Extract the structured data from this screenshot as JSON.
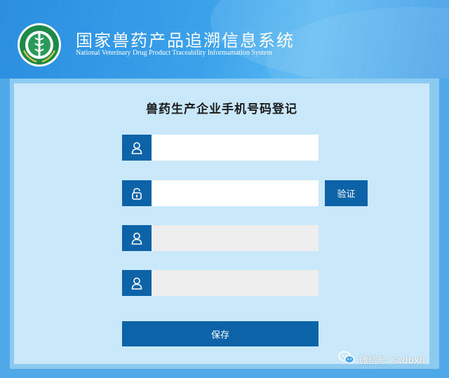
{
  "header": {
    "title_cn": "国家兽药产品追溯信息系统",
    "title_en": "National Veterinary Drug Product Traceability Informamation System",
    "logo_icon": "veterinary-emblem-icon"
  },
  "form": {
    "title": "兽药生产企业手机号码登记",
    "fields": [
      {
        "icon": "user-icon",
        "value": "",
        "placeholder": ""
      },
      {
        "icon": "lock-icon",
        "value": "",
        "placeholder": ""
      },
      {
        "icon": "user-icon",
        "value": "",
        "placeholder": ""
      },
      {
        "icon": "user-icon",
        "value": "",
        "placeholder": ""
      }
    ],
    "verify_label": "验证",
    "save_label": "保存"
  },
  "watermark": {
    "text": "微信号: scdbxh",
    "icon": "wechat-icon"
  },
  "colors": {
    "accent": "#0d63a8",
    "panel": "#c9e9fa",
    "header": "#3aa1ea"
  }
}
